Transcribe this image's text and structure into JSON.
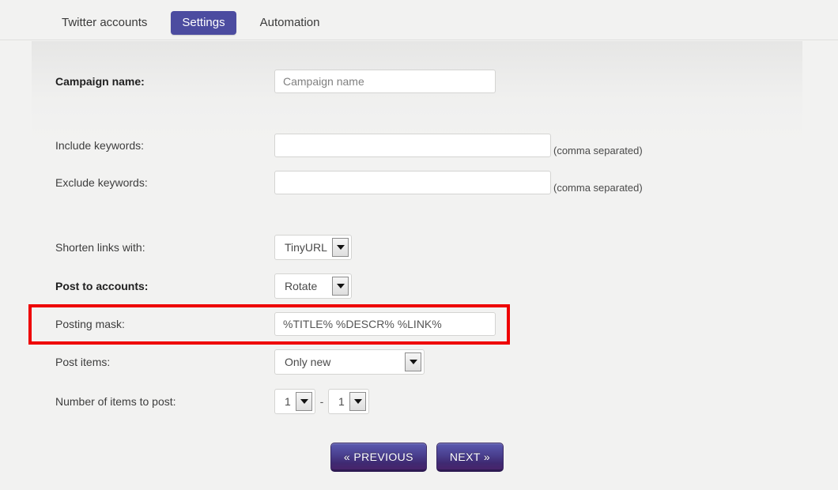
{
  "tabs": [
    {
      "label": "Twitter accounts",
      "active": false
    },
    {
      "label": "Settings",
      "active": true
    },
    {
      "label": "Automation",
      "active": false
    }
  ],
  "form": {
    "campaign_name": {
      "label": "Campaign name:",
      "value": "",
      "placeholder": "Campaign name"
    },
    "include_keywords": {
      "label": "Include keywords:",
      "value": "",
      "hint": "(comma separated)"
    },
    "exclude_keywords": {
      "label": "Exclude keywords:",
      "value": "",
      "hint": "(comma separated)"
    },
    "shorten_links": {
      "label": "Shorten links with:",
      "selected": "TinyURL"
    },
    "post_to_accounts": {
      "label": "Post to accounts:",
      "selected": "Rotate"
    },
    "posting_mask": {
      "label": "Posting mask:",
      "value": "%TITLE% %DESCR% %LINK%"
    },
    "post_items": {
      "label": "Post items:",
      "selected": "Only new"
    },
    "number_of_items": {
      "label": "Number of items to post:",
      "from": "1",
      "to": "1",
      "separator": "-"
    }
  },
  "nav": {
    "previous_label": "« PREVIOUS",
    "next_label": "NEXT »"
  },
  "colors": {
    "accent": "#4c4ca0",
    "highlight": "#ee0000",
    "button_gradient_top": "#5b5bb0",
    "button_gradient_bottom": "#47246b",
    "page_background": "#f2f2f1"
  }
}
